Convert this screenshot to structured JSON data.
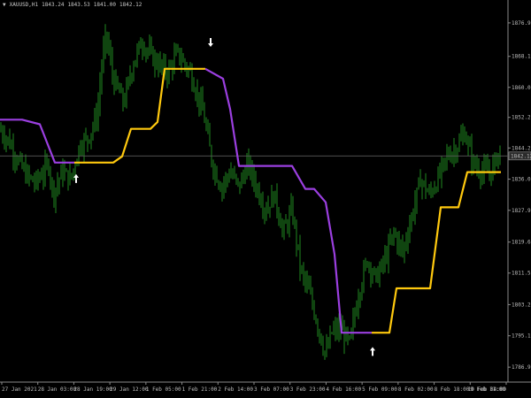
{
  "header": {
    "menu_glyph": "▼",
    "symbol": "XAUUSD,H1",
    "open": "1843.24",
    "high": "1843.53",
    "low": "1841.00",
    "close": "1842.12"
  },
  "colors": {
    "background": "#000000",
    "candles": "#1f8a1f",
    "trail_bull": "#ffc90e",
    "trail_bear": "#9b3fe0",
    "arrow": "#ffffff",
    "axis": "#bdbdbd",
    "price_line": "#5a5a5a"
  },
  "chart_data": {
    "type": "line",
    "ylim": [
      1783.0,
      1881.5
    ],
    "current_price": "1842.12",
    "y_ticks": [
      "1876.90",
      "1868.15",
      "1860.05",
      "1852.20",
      "1844.20",
      "1836.05",
      "1827.90",
      "1819.60",
      "1811.50",
      "1803.25",
      "1795.10",
      "1786.90"
    ],
    "x_ticks": [
      "27 Jan 2021",
      "28 Jan 03:00",
      "28 Jan 19:00",
      "29 Jan 12:00",
      "1 Feb 05:00",
      "1 Feb 21:00",
      "2 Feb 14:00",
      "3 Feb 07:00",
      "3 Feb 23:00",
      "4 Feb 16:00",
      "5 Feb 09:00",
      "8 Feb 02:00",
      "8 Feb 18:00",
      "9 Feb 11:00",
      "10 Feb 04:00"
    ],
    "price_series_anchors": [
      [
        0,
        1849
      ],
      [
        10,
        1846
      ],
      [
        20,
        1841
      ],
      [
        30,
        1837
      ],
      [
        40,
        1835
      ],
      [
        55,
        1840
      ],
      [
        60,
        1832
      ],
      [
        70,
        1838
      ],
      [
        80,
        1836
      ],
      [
        90,
        1845
      ],
      [
        100,
        1847
      ],
      [
        110,
        1853
      ],
      [
        115,
        1866
      ],
      [
        120,
        1874
      ],
      [
        128,
        1862
      ],
      [
        140,
        1856
      ],
      [
        150,
        1866
      ],
      [
        160,
        1872
      ],
      [
        175,
        1867
      ],
      [
        190,
        1864
      ],
      [
        200,
        1869
      ],
      [
        215,
        1864
      ],
      [
        230,
        1853
      ],
      [
        240,
        1840
      ],
      [
        250,
        1834
      ],
      [
        260,
        1838
      ],
      [
        270,
        1834
      ],
      [
        280,
        1840
      ],
      [
        290,
        1834
      ],
      [
        300,
        1828
      ],
      [
        310,
        1832
      ],
      [
        320,
        1822
      ],
      [
        330,
        1828
      ],
      [
        340,
        1812
      ],
      [
        350,
        1806
      ],
      [
        360,
        1797
      ],
      [
        368,
        1790
      ],
      [
        375,
        1796
      ],
      [
        385,
        1797
      ],
      [
        395,
        1793
      ],
      [
        405,
        1806
      ],
      [
        415,
        1815
      ],
      [
        425,
        1810
      ],
      [
        435,
        1815
      ],
      [
        445,
        1822
      ],
      [
        455,
        1817
      ],
      [
        465,
        1826
      ],
      [
        475,
        1836
      ],
      [
        485,
        1832
      ],
      [
        495,
        1836
      ],
      [
        505,
        1842
      ],
      [
        515,
        1844
      ],
      [
        525,
        1848
      ],
      [
        535,
        1840
      ],
      [
        545,
        1838
      ],
      [
        555,
        1838
      ],
      [
        565,
        1844
      ]
    ],
    "trail": [
      {
        "trend": "bull",
        "color": "#ffc90e",
        "points": [
          [
            84,
            1840.4
          ],
          [
            110,
            1840.4
          ],
          [
            128,
            1840.4
          ],
          [
            138,
            1842.0
          ],
          [
            148,
            1849.2
          ],
          [
            170,
            1849.2
          ],
          [
            178,
            1851.0
          ],
          [
            186,
            1864.9
          ],
          [
            232,
            1864.9
          ]
        ]
      },
      {
        "trend": "bear",
        "color": "#9b3fe0",
        "points": [
          [
            0,
            1851.6
          ],
          [
            25,
            1851.6
          ],
          [
            45,
            1850.4
          ],
          [
            62,
            1840.4
          ],
          [
            84,
            1840.4
          ]
        ]
      },
      {
        "trend": "bear",
        "color": "#9b3fe0",
        "points": [
          [
            232,
            1864.9
          ],
          [
            252,
            1862.3
          ],
          [
            260,
            1854.4
          ],
          [
            270,
            1839.5
          ],
          [
            330,
            1839.5
          ],
          [
            345,
            1833.5
          ],
          [
            355,
            1833.5
          ],
          [
            368,
            1830.0
          ],
          [
            378,
            1816.4
          ],
          [
            386,
            1795.9
          ],
          [
            420,
            1795.9
          ]
        ]
      },
      {
        "trend": "bull",
        "color": "#ffc90e",
        "points": [
          [
            420,
            1795.9
          ],
          [
            440,
            1795.9
          ],
          [
            448,
            1807.5
          ],
          [
            486,
            1807.5
          ],
          [
            498,
            1828.7
          ],
          [
            518,
            1828.7
          ],
          [
            528,
            1837.9
          ],
          [
            566,
            1837.9
          ]
        ]
      }
    ],
    "signals": [
      {
        "type": "buy",
        "x_bar": 86,
        "price": 1836.2
      },
      {
        "type": "sell",
        "x_bar": 238,
        "price": 1871.8
      },
      {
        "type": "buy",
        "x_bar": 421,
        "price": 1791.0
      }
    ]
  }
}
